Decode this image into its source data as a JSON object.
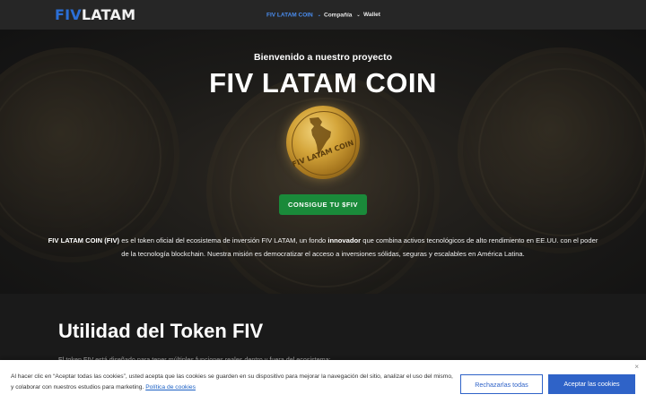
{
  "header": {
    "logo_part1": "FIV",
    "logo_part2": "LATAM",
    "nav": [
      {
        "label": "FIV LATAM COIN",
        "has_dropdown": true,
        "active": true
      },
      {
        "label": "Compañía",
        "has_dropdown": true,
        "active": false
      },
      {
        "label": "Wallet",
        "has_dropdown": false,
        "active": false
      }
    ]
  },
  "hero": {
    "subtitle": "Bienvenido a nuestro proyecto",
    "title": "FIV LATAM COIN",
    "coin_text": "FIV LATAM COIN",
    "cta_label": "CONSIGUE TU $FIV",
    "desc": {
      "bold1": "FIV LATAM COIN (FIV)",
      "text1": " es el token oficial del ecosistema de inversión FIV LATAM, un fondo ",
      "bold2": "innovador",
      "text2": " que combina activos tecnológicos de alto rendimiento en EE.UU. con el poder de la tecnología blockchain. Nuestra misión es democratizar el acceso a inversiones sólidas, seguras y escalables en América Latina."
    }
  },
  "section": {
    "heading": "Utilidad del Token FIV",
    "partial_text": "El token FIV está diseñado para tener múltiples funciones reales dentro y fuera del ecosistema:"
  },
  "cookie": {
    "message": "Al hacer clic en “Aceptar todas las cookies”, usted acepta que las cookies se guarden en su dispositivo para mejorar la navegación del sitio, analizar el uso del mismo, y colaborar con nuestros estudios para marketing.",
    "policy_link": "Política de cookies",
    "reject_label": "Rechazarlas todas",
    "accept_label": "Aceptar las cookies",
    "close_icon": "×"
  },
  "colors": {
    "accent_blue": "#2b6fd6",
    "cta_green": "#1a8a3a",
    "cookie_button_blue": "#2f63c8"
  }
}
